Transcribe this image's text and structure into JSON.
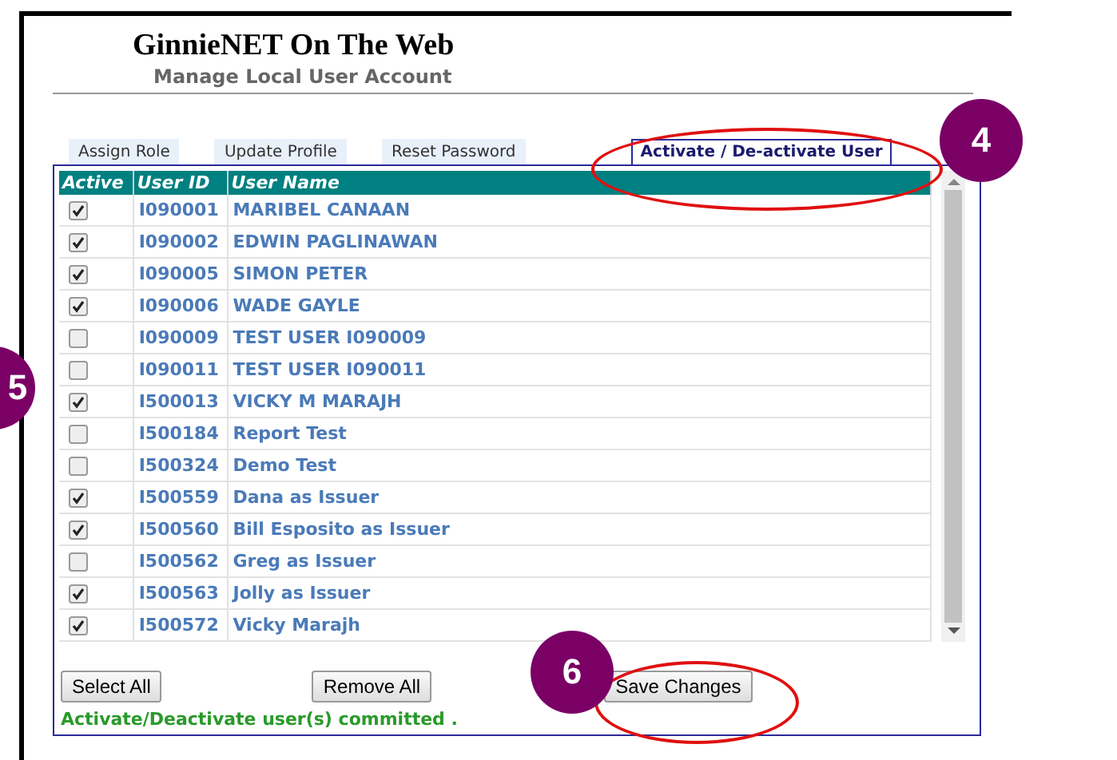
{
  "header": {
    "title": "GinnieNET On The Web",
    "subtitle": "Manage Local User Account"
  },
  "tabs": [
    {
      "label": "Assign Role",
      "selected": false
    },
    {
      "label": "Update Profile",
      "selected": false
    },
    {
      "label": "Reset Password",
      "selected": false
    },
    {
      "label": "Activate / De-activate User",
      "selected": true
    }
  ],
  "table": {
    "columns": [
      "Active",
      "User ID",
      "User Name"
    ],
    "rows": [
      {
        "active": true,
        "user_id": "I090001",
        "user_name": "MARIBEL CANAAN"
      },
      {
        "active": true,
        "user_id": "I090002",
        "user_name": "EDWIN PAGLINAWAN"
      },
      {
        "active": true,
        "user_id": "I090005",
        "user_name": "SIMON PETER"
      },
      {
        "active": true,
        "user_id": "I090006",
        "user_name": "WADE GAYLE"
      },
      {
        "active": false,
        "user_id": "I090009",
        "user_name": "TEST USER I090009"
      },
      {
        "active": false,
        "user_id": "I090011",
        "user_name": "TEST USER I090011"
      },
      {
        "active": true,
        "user_id": "I500013",
        "user_name": "VICKY M MARAJH"
      },
      {
        "active": false,
        "user_id": "I500184",
        "user_name": "Report Test"
      },
      {
        "active": false,
        "user_id": "I500324",
        "user_name": "Demo Test"
      },
      {
        "active": true,
        "user_id": "I500559",
        "user_name": "Dana as Issuer"
      },
      {
        "active": true,
        "user_id": "I500560",
        "user_name": "Bill Esposito as Issuer"
      },
      {
        "active": false,
        "user_id": "I500562",
        "user_name": "Greg as Issuer"
      },
      {
        "active": true,
        "user_id": "I500563",
        "user_name": "Jolly as Issuer"
      },
      {
        "active": true,
        "user_id": "I500572",
        "user_name": "Vicky Marajh"
      }
    ]
  },
  "buttons": [
    "Select All",
    "Remove All",
    "Save Changes"
  ],
  "status_message": "Activate/Deactivate user(s) committed .",
  "callouts": [
    {
      "number": "4"
    },
    {
      "number": "5"
    },
    {
      "number": "6"
    }
  ]
}
